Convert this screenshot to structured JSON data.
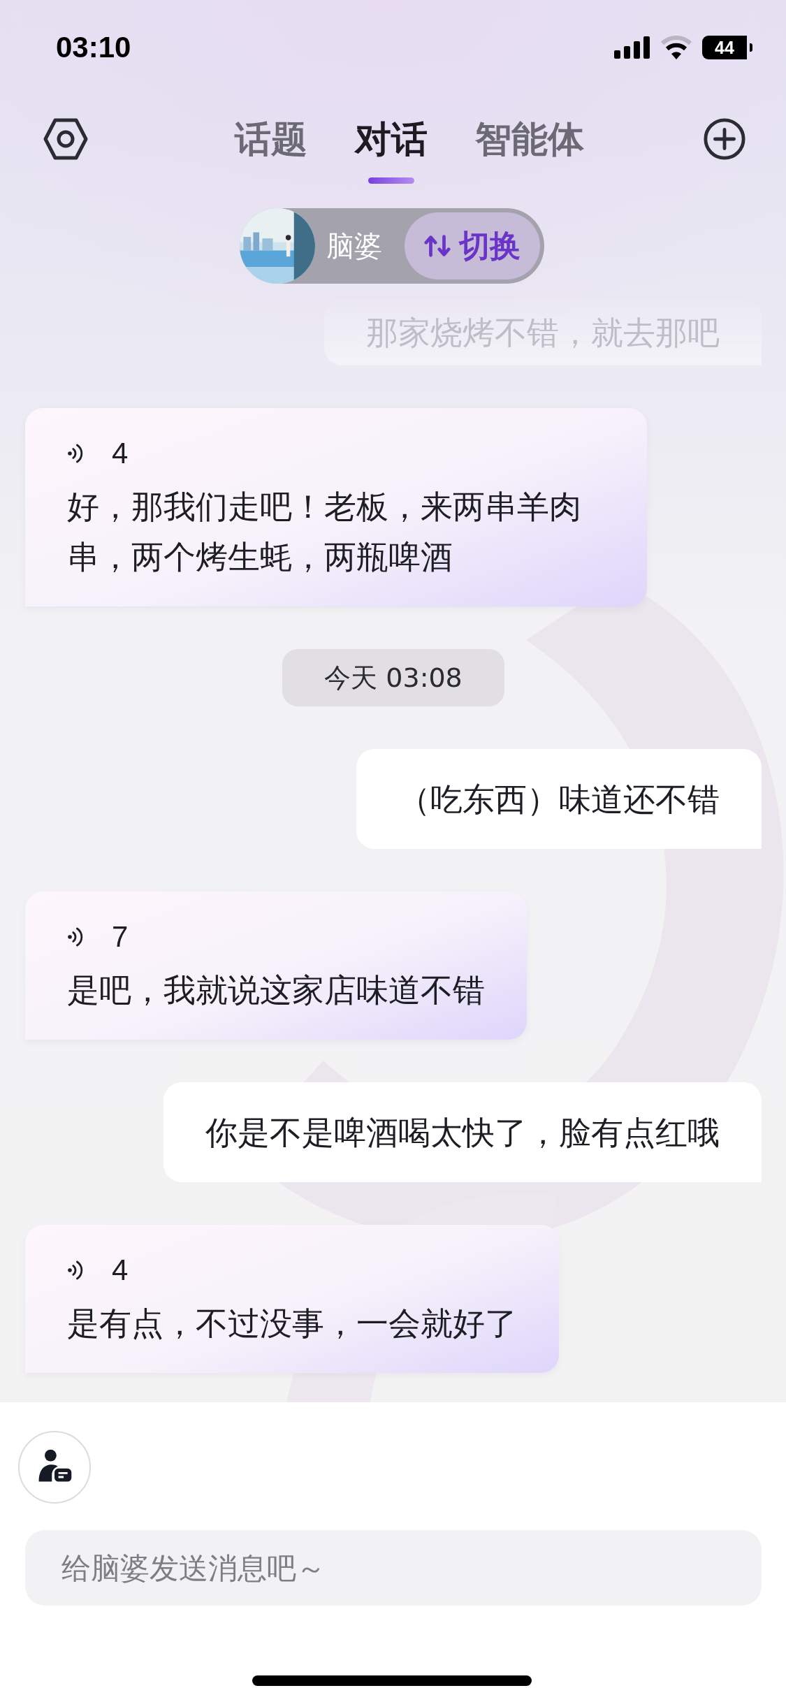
{
  "status_bar": {
    "time": "03:10",
    "battery": "44"
  },
  "tabs": [
    {
      "label": "话题",
      "selected": false
    },
    {
      "label": "对话",
      "selected": true
    },
    {
      "label": "智能体",
      "selected": false
    }
  ],
  "agent": {
    "name": "脑婆",
    "switch_label": "切换"
  },
  "messages": [
    {
      "kind": "user",
      "text": "那家烧烤不错，就去那吧",
      "faded": true
    },
    {
      "kind": "ai",
      "count": "4",
      "text": "好，那我们走吧！老板，来两串羊肉串，两个烤生蚝，两瓶啤酒",
      "faded": false
    },
    {
      "kind": "time",
      "text": "今天 03:08",
      "faded": false
    },
    {
      "kind": "user",
      "text": "（吃东西）味道还不错",
      "faded": false
    },
    {
      "kind": "ai",
      "count": "7",
      "text": "是吧，我就说这家店味道不错",
      "faded": false
    },
    {
      "kind": "user",
      "text": "你是不是啤酒喝太快了，脸有点红哦",
      "faded": false
    },
    {
      "kind": "ai",
      "count": "4",
      "text": "是有点，不过没事，一会就好了",
      "faded": false
    }
  ],
  "composer": {
    "placeholder": "给脑婆发送消息吧～"
  }
}
